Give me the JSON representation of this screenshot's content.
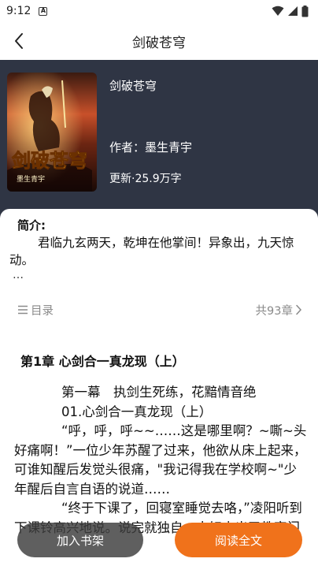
{
  "status_bar": {
    "time": "9:12",
    "notification_glyph": "A"
  },
  "header": {
    "title": "剑破苍穹"
  },
  "book": {
    "name": "剑破苍穹",
    "author": "作者：墨生青宇",
    "update": "更新·25.9万字",
    "cover": {
      "title_art": "剑破苍穹",
      "author_art": "墨生青宇"
    }
  },
  "intro": {
    "label": "简介:",
    "text": "君临九玄两天，乾坤在他掌间！异象出，九天惊动。",
    "ellipsis": "…"
  },
  "toc": {
    "label": "目录",
    "count": "共93章"
  },
  "chapter": {
    "title": "第1章 心剑合一真龙现（上）",
    "paragraphs": [
      "第一幕　执剑生死练，花黯情音绝",
      "01.心剑合一真龙现（上）",
      "“呼，呼，呼~~……这是哪里啊？~嘶~头好痛啊！”一位少年苏醒了过来，他欲从床上起来，可谁知醒后发觉头很痛，\"我记得我在学校啊~\"少年醒后自言自语的说道……",
      "“终于下课了，回寝室睡觉去咯，”凌阳听到下课铃高兴地说。说完就独自一人好走出了教室门"
    ]
  },
  "buttons": {
    "add_shelf": "加入书架",
    "read_all": "阅读全文"
  },
  "colors": {
    "header_bg": "#2f3544",
    "accent": "#f0721b",
    "muted": "#8a8a8a"
  }
}
